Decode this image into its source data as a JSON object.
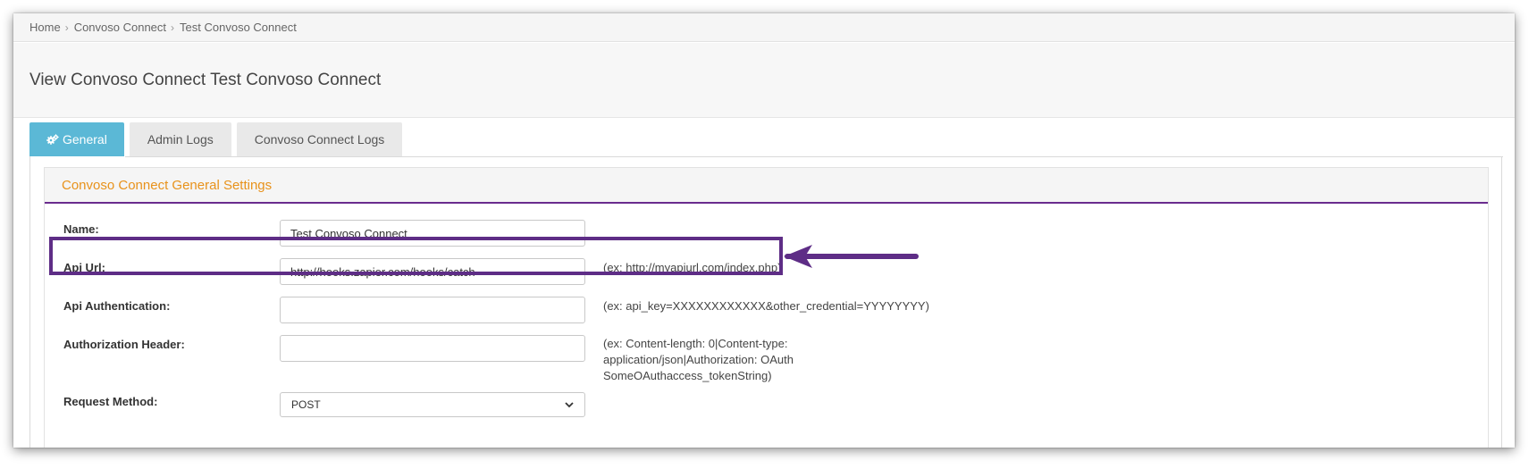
{
  "breadcrumb": {
    "items": [
      "Home",
      "Convoso Connect",
      "Test Convoso Connect"
    ],
    "separator": "›"
  },
  "page": {
    "title": "View Convoso Connect Test Convoso Connect"
  },
  "tabs": [
    {
      "label": "General",
      "active": true,
      "icon": "gears-icon"
    },
    {
      "label": "Admin Logs",
      "active": false
    },
    {
      "label": "Convoso Connect Logs",
      "active": false
    }
  ],
  "settings": {
    "title": "Convoso Connect General Settings",
    "fields": {
      "name": {
        "label": "Name:",
        "value": "Test Convoso Connect",
        "hint": ""
      },
      "api_url": {
        "label": "Api Url:",
        "value": "http://hooks.zapier.com/hooks/catch",
        "hint": "(ex: http://myapiurl.com/index.php)"
      },
      "api_auth": {
        "label": "Api Authentication:",
        "value": "",
        "hint": "(ex: api_key=XXXXXXXXXXXX&other_credential=YYYYYYYY)"
      },
      "auth_header": {
        "label": "Authorization Header:",
        "value": "",
        "hint_lines": [
          "(ex: Content-length: 0|Content-type:",
          "application/json|Authorization: OAuth",
          "SomeOAuthaccess_tokenString)"
        ]
      },
      "request_method": {
        "label": "Request Method:",
        "value": "POST"
      }
    }
  },
  "colors": {
    "tab_active": "#5bb8d6",
    "card_title": "#e8921b",
    "accent_purple": "#5e2d86"
  }
}
